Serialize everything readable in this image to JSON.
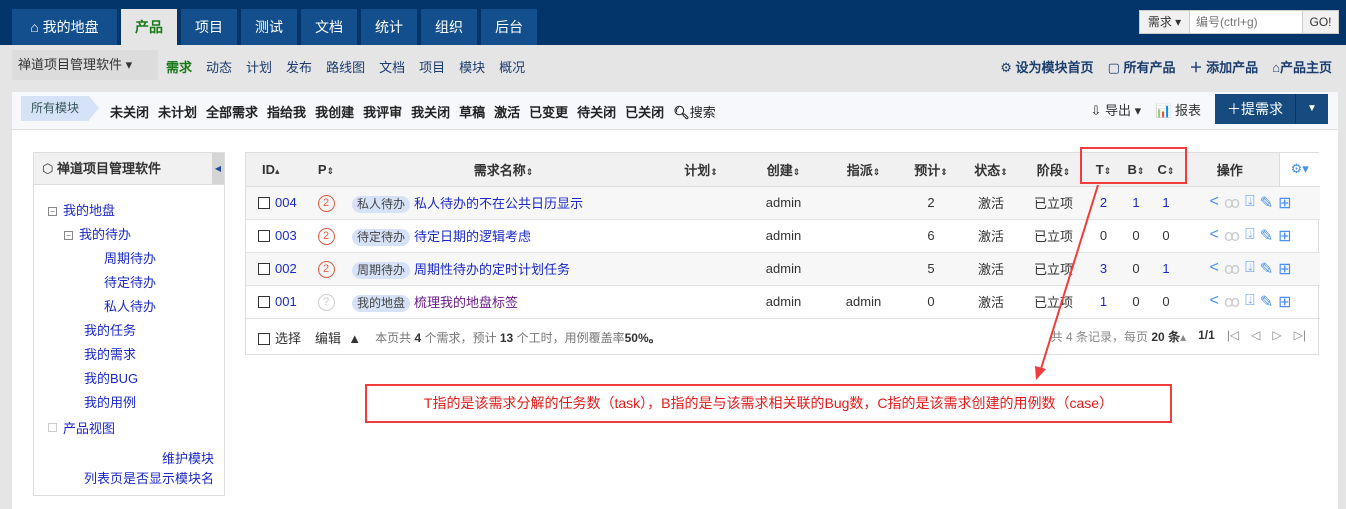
{
  "top": {
    "tabs": [
      "我的地盘",
      "产品",
      "项目",
      "测试",
      "文档",
      "统计",
      "组织",
      "后台"
    ],
    "active": 1,
    "search_type": "需求",
    "search_placeholder": "编号(ctrl+g)",
    "go": "GO!"
  },
  "subnav": {
    "product": "禅道项目管理软件",
    "items": [
      "需求",
      "动态",
      "计划",
      "发布",
      "路线图",
      "文档",
      "项目",
      "模块",
      "概况"
    ],
    "right": [
      "设为模块首页",
      "所有产品",
      "添加产品",
      "产品主页"
    ]
  },
  "filter": {
    "module": "所有模块",
    "items": [
      "未关闭",
      "未计划",
      "全部需求",
      "指给我",
      "我创建",
      "我评审",
      "我关闭",
      "草稿",
      "激活",
      "已变更",
      "待关闭",
      "已关闭",
      "搜索"
    ],
    "export": "导出",
    "report": "报表",
    "add": "提需求"
  },
  "sidebar": {
    "title": "禅道项目管理软件",
    "tree": [
      "我的地盘",
      "我的待办",
      "周期待办",
      "待定待办",
      "私人待办",
      "我的任务",
      "我的需求",
      "我的BUG",
      "我的用例",
      "产品视图"
    ],
    "footer": [
      "维护模块",
      "列表页是否显示模块名"
    ]
  },
  "table": {
    "headers": [
      "ID",
      "P",
      "需求名称",
      "计划",
      "创建",
      "指派",
      "预计",
      "状态",
      "阶段",
      "T",
      "B",
      "C",
      "操作"
    ],
    "rows": [
      {
        "id": "004",
        "pri": "2",
        "tag": "私人待办",
        "name": "私人待办的不在公共日历显示",
        "plan": "",
        "creator": "admin",
        "assigned": "",
        "estimate": "2",
        "status": "激活",
        "stage": "已立项",
        "t": "2",
        "b": "1",
        "c": "1"
      },
      {
        "id": "003",
        "pri": "2",
        "tag": "待定待办",
        "name": "待定日期的逻辑考虑",
        "plan": "",
        "creator": "admin",
        "assigned": "",
        "estimate": "6",
        "status": "激活",
        "stage": "已立项",
        "t": "0",
        "b": "0",
        "c": "0"
      },
      {
        "id": "002",
        "pri": "2",
        "tag": "周期待办",
        "name": "周期性待办的定时计划任务",
        "plan": "",
        "creator": "admin",
        "assigned": "",
        "estimate": "5",
        "status": "激活",
        "stage": "已立项",
        "t": "3",
        "b": "0",
        "c": "1"
      },
      {
        "id": "001",
        "pri": "?",
        "tag": "我的地盘",
        "name": "梳理我的地盘标签",
        "plan": "",
        "creator": "admin",
        "assigned": "admin",
        "estimate": "0",
        "status": "激活",
        "stage": "已立项",
        "t": "1",
        "b": "0",
        "c": "0"
      }
    ],
    "footer": {
      "select": "选择",
      "edit": "编辑",
      "summary_a": "本页共",
      "count": "4",
      "summary_b": "个需求，预计",
      "hours": "13",
      "summary_c": "个工时，用例覆盖率",
      "coverage": "50%。",
      "records": "共 4 条记录，每页",
      "per_page": "20",
      "unit": "条",
      "page": "1/1"
    }
  },
  "annotation": "T指的是该需求分解的任务数（task），B指的是与该需求相关联的Bug数，C指的是该需求创建的用例数（case）",
  "colors": {
    "nav": "#03346a",
    "tab": "#134f8c",
    "accent": "#1a7a1a",
    "link": "#1a28c8",
    "note": "#f03c3c"
  }
}
